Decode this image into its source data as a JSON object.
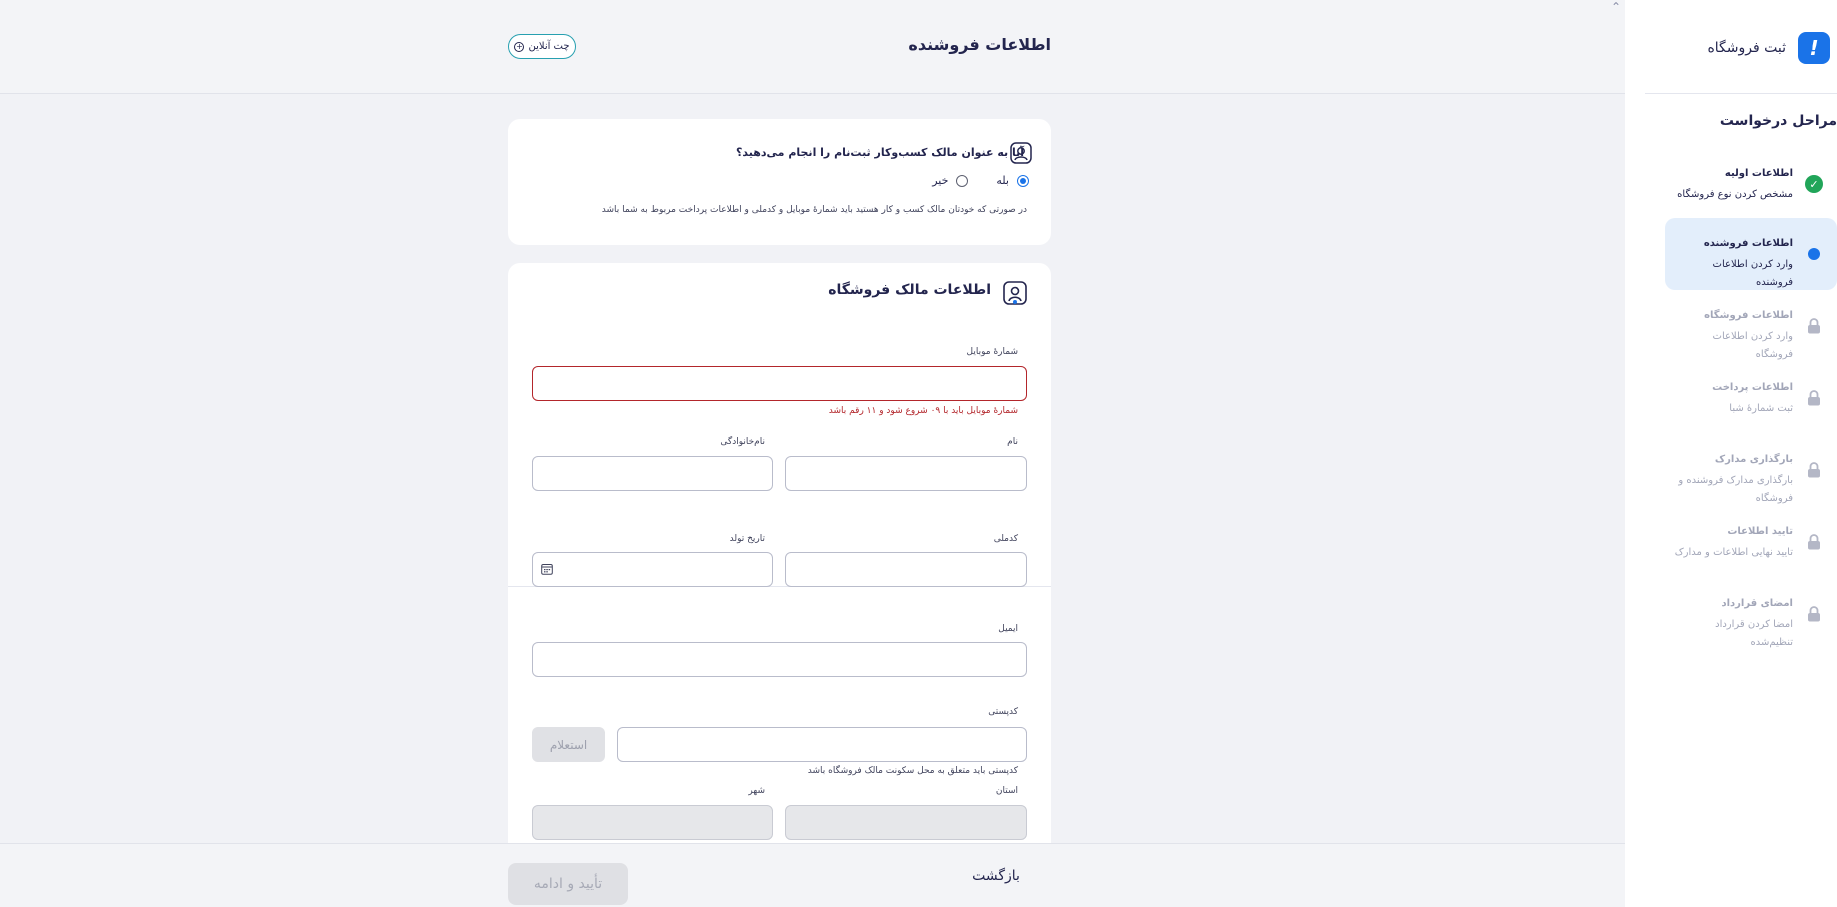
{
  "sidebar": {
    "brand_title": "ثبت فروشگاه",
    "steps_heading": "مراحل درخواست",
    "steps": [
      {
        "title": "اطلاعات اولیه",
        "desc": "مشخص کردن نوع فروشگاه",
        "status": "done"
      },
      {
        "title": "اطلاعات فروشنده",
        "desc": "وارد کردن اطلاعات فروشنده",
        "status": "active"
      },
      {
        "title": "اطلاعات فروشگاه",
        "desc": "وارد کردن اطلاعات فروشگاه",
        "status": "locked"
      },
      {
        "title": "اطلاعات پرداخت",
        "desc": "ثبت شمارهٔ شبا",
        "status": "locked"
      },
      {
        "title": "بارگذاری مدارک",
        "desc": "بارگذاری مدارک فروشنده و فروشگاه",
        "status": "locked"
      },
      {
        "title": "تایید اطلاعات",
        "desc": "تایید نهایی اطلاعات و مدارک",
        "status": "locked"
      },
      {
        "title": "امضای قرارداد",
        "desc": "امضا کردن قرارداد تنظیم‌شده",
        "status": "locked"
      }
    ]
  },
  "header": {
    "title": "اطلاعات فروشنده",
    "chat_label": "چت آنلاین"
  },
  "owner_card": {
    "question": "آیا به عنوان مالک کسب‌وکار ثبت‌نام را انجام می‌دهید؟",
    "yes_label": "بله",
    "no_label": "خیر",
    "selected": "yes",
    "note": "در صورتی که خودتان مالک کسب و کار هستید باید شمارهٔ موبایل و کدملی و اطلاعات پرداخت مربوط به شما باشد"
  },
  "form": {
    "title": "اطلاعات مالک فروشگاه",
    "mobile_label": "شمارهٔ موبایل",
    "mobile_value": "",
    "mobile_error": "شمارهٔ موبایل باید با ۰۹ شروع شود و ۱۱ رقم باشد",
    "first_name_label": "نام",
    "last_name_label": "نام‌خانوادگی",
    "national_code_label": "کدملی",
    "birth_date_label": "تاریخ تولد",
    "email_label": "ایمیل",
    "postal_code_label": "کدپستی",
    "inquiry_label": "استعلام",
    "postal_hint": "کدپستی باید متعلق به محل سکونت مالک فروشگاه باشد",
    "province_label": "استان",
    "city_label": "شهر"
  },
  "footer": {
    "back_label": "بازگشت",
    "confirm_label": "تأیید و ادامه"
  },
  "colors": {
    "accent": "#1a73e8",
    "success": "#21a559",
    "error": "#b3262b",
    "chat_border": "#27a0b0"
  }
}
